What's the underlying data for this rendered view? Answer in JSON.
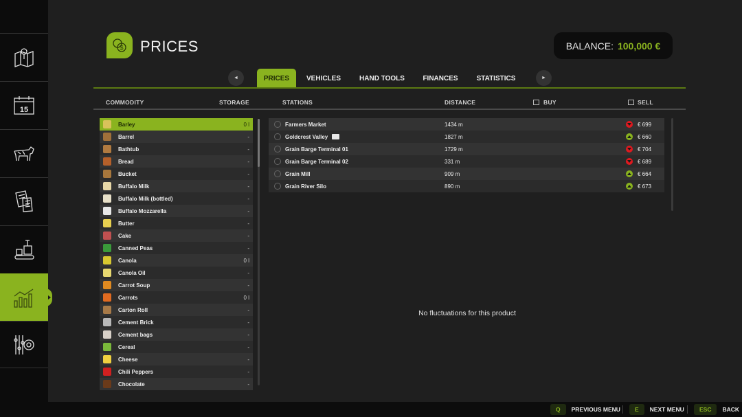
{
  "sidebar": {
    "items": [
      {
        "name": "map",
        "icon": "map-pin-icon",
        "active": false
      },
      {
        "name": "calendar",
        "icon": "calendar-icon",
        "label": "15",
        "active": false
      },
      {
        "name": "animals",
        "icon": "cow-icon",
        "active": false
      },
      {
        "name": "contracts",
        "icon": "documents-icon",
        "active": false
      },
      {
        "name": "production",
        "icon": "production-icon",
        "active": false
      },
      {
        "name": "prices",
        "icon": "chart-icon",
        "active": true
      },
      {
        "name": "settings",
        "icon": "settings-icon",
        "active": false
      }
    ]
  },
  "header": {
    "title": "PRICES",
    "icon": "coins-icon",
    "balance_label": "BALANCE:",
    "balance_value": "100,000 €"
  },
  "tabs": {
    "prev": "◄",
    "next": "►",
    "items": [
      "PRICES",
      "VEHICLES",
      "HAND TOOLS",
      "FINANCES",
      "STATISTICS"
    ],
    "active": "PRICES"
  },
  "columns": {
    "commodity": "COMMODITY",
    "storage": "STORAGE",
    "stations": "STATIONS",
    "distance": "DISTANCE",
    "buy": "BUY",
    "sell": "SELL"
  },
  "commodities": [
    {
      "name": "Barley",
      "storage": "0 l",
      "color": "#d9c25a",
      "selected": true
    },
    {
      "name": "Barrel",
      "storage": "-",
      "color": "#a0703a"
    },
    {
      "name": "Bathtub",
      "storage": "-",
      "color": "#b07a40"
    },
    {
      "name": "Bread",
      "storage": "-",
      "color": "#b5602a"
    },
    {
      "name": "Bucket",
      "storage": "-",
      "color": "#a8773c"
    },
    {
      "name": "Buffalo Milk",
      "storage": "-",
      "color": "#e8d8a8"
    },
    {
      "name": "Buffalo Milk (bottled)",
      "storage": "-",
      "color": "#e8e0c8"
    },
    {
      "name": "Buffalo Mozzarella",
      "storage": "-",
      "color": "#e8e8e8"
    },
    {
      "name": "Butter",
      "storage": "-",
      "color": "#e8d050"
    },
    {
      "name": "Cake",
      "storage": "-",
      "color": "#c05050"
    },
    {
      "name": "Canned Peas",
      "storage": "-",
      "color": "#3a9a3a"
    },
    {
      "name": "Canola",
      "storage": "0 l",
      "color": "#d8c830"
    },
    {
      "name": "Canola Oil",
      "storage": "-",
      "color": "#e8d870"
    },
    {
      "name": "Carrot Soup",
      "storage": "-",
      "color": "#e08a20"
    },
    {
      "name": "Carrots",
      "storage": "0 l",
      "color": "#e06a20"
    },
    {
      "name": "Carton Roll",
      "storage": "-",
      "color": "#a87a48"
    },
    {
      "name": "Cement Brick",
      "storage": "-",
      "color": "#b8b8b8"
    },
    {
      "name": "Cement bags",
      "storage": "-",
      "color": "#d8d0c8"
    },
    {
      "name": "Cereal",
      "storage": "-",
      "color": "#7ab83a"
    },
    {
      "name": "Cheese",
      "storage": "-",
      "color": "#f0d040"
    },
    {
      "name": "Chili Peppers",
      "storage": "-",
      "color": "#d02020"
    },
    {
      "name": "Chocolate",
      "storage": "-",
      "color": "#6a3a1a"
    }
  ],
  "stations": [
    {
      "name": "Farmers Market",
      "train": false,
      "distance": "1434 m",
      "trend": "down",
      "sell": "€ 699"
    },
    {
      "name": "Goldcrest Valley",
      "train": true,
      "distance": "1827 m",
      "trend": "up",
      "sell": "€ 660"
    },
    {
      "name": "Grain Barge Terminal 01",
      "train": false,
      "distance": "1729 m",
      "trend": "down",
      "sell": "€ 704"
    },
    {
      "name": "Grain Barge Terminal 02",
      "train": false,
      "distance": "331 m",
      "trend": "down",
      "sell": "€ 689"
    },
    {
      "name": "Grain Mill",
      "train": false,
      "distance": "909 m",
      "trend": "up",
      "sell": "€ 664"
    },
    {
      "name": "Grain River Silo",
      "train": false,
      "distance": "890 m",
      "trend": "up",
      "sell": "€ 673"
    }
  ],
  "fluctuation_message": "No fluctuations for this product",
  "footer": {
    "buttons": [
      {
        "key": "Q",
        "label": "PREVIOUS MENU"
      },
      {
        "key": "E",
        "label": "NEXT MENU"
      },
      {
        "key": "ESC",
        "label": "BACK"
      }
    ]
  }
}
